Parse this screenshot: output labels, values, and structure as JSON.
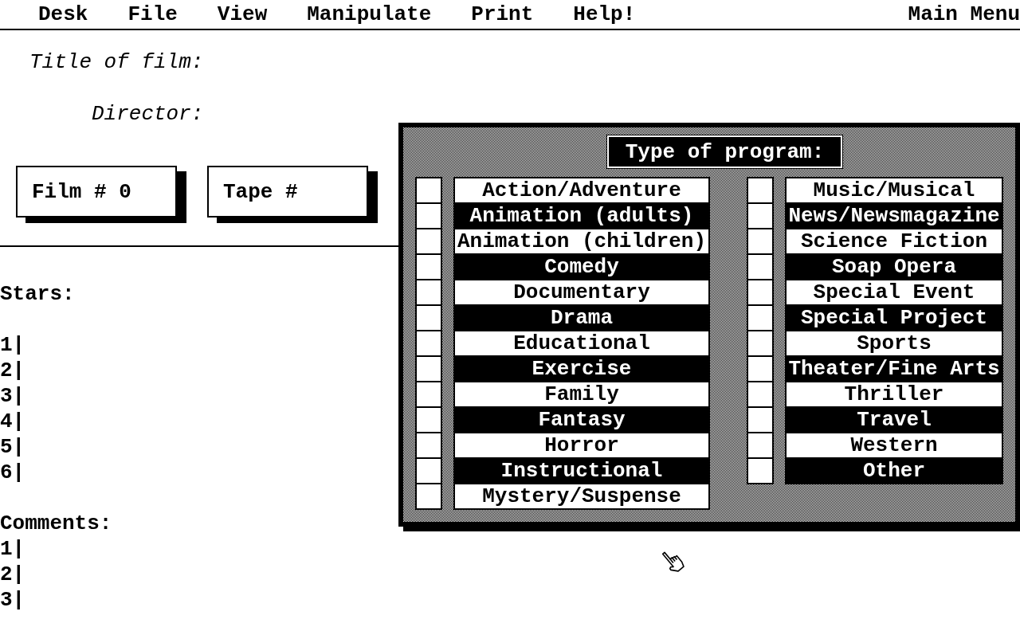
{
  "menu_bar": {
    "items": [
      "Desk",
      "File",
      "View",
      "Manipulate",
      "Print",
      "Help!"
    ],
    "title": "Main Menu"
  },
  "form": {
    "title_label": "Title of film:",
    "director_label": "Director:",
    "number_boxes": [
      "Film # 0",
      "Tape #"
    ]
  },
  "stars": {
    "label": "Stars:",
    "lines": [
      "1|",
      "2|",
      "3|",
      "4|",
      "5|",
      "6|"
    ]
  },
  "comments": {
    "label": "Comments:",
    "lines": [
      "1|",
      "2|",
      "3|"
    ]
  },
  "dialog": {
    "title": "Type of program:",
    "columns": [
      {
        "items": [
          {
            "label": "Action/Adventure",
            "checked": false
          },
          {
            "label": "Animation (adults)",
            "checked": false
          },
          {
            "label": "Animation (children)",
            "checked": false
          },
          {
            "label": "Comedy",
            "checked": false
          },
          {
            "label": "Documentary",
            "checked": false
          },
          {
            "label": "Drama",
            "checked": false
          },
          {
            "label": "Educational",
            "checked": false
          },
          {
            "label": "Exercise",
            "checked": false
          },
          {
            "label": "Family",
            "checked": false
          },
          {
            "label": "Fantasy",
            "checked": false
          },
          {
            "label": "Horror",
            "checked": false
          },
          {
            "label": "Instructional",
            "checked": false
          },
          {
            "label": "Mystery/Suspense",
            "checked": false
          }
        ]
      },
      {
        "items": [
          {
            "label": "Music/Musical",
            "checked": false
          },
          {
            "label": "News/Newsmagazine",
            "checked": false
          },
          {
            "label": "Science Fiction",
            "checked": false
          },
          {
            "label": "Soap Opera",
            "checked": false
          },
          {
            "label": "Special Event",
            "checked": false
          },
          {
            "label": "Special Project",
            "checked": false
          },
          {
            "label": "Sports",
            "checked": false
          },
          {
            "label": "Theater/Fine Arts",
            "checked": false
          },
          {
            "label": "Thriller",
            "checked": false
          },
          {
            "label": "Travel",
            "checked": false
          },
          {
            "label": "Western",
            "checked": false
          },
          {
            "label": "Other",
            "checked": false
          }
        ]
      }
    ]
  }
}
